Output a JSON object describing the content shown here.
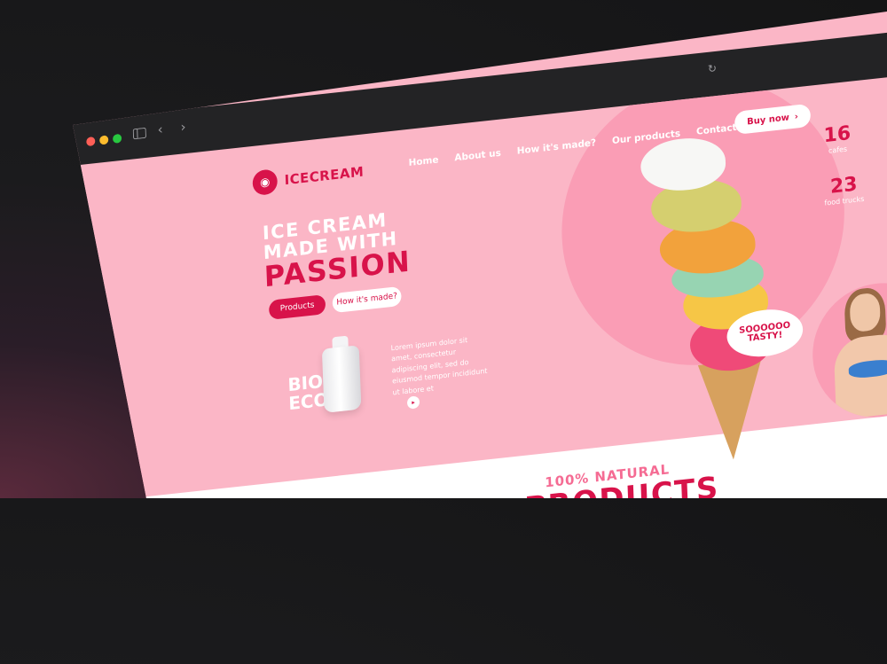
{
  "browser": {
    "refresh_icon": "refresh-icon",
    "sidebar_icon": "sidebar-icon",
    "back_icon": "chevron-left-icon",
    "forward_icon": "chevron-right-icon"
  },
  "site": {
    "brand": "ICECREAM",
    "nav": [
      "Home",
      "About us",
      "How it's made?",
      "Our products",
      "Contact"
    ],
    "buy_button": "Buy now",
    "hero": {
      "line1": "ICE CREAM",
      "line2": "MADE WITH",
      "line3": "PASSION",
      "primary_button": "Products",
      "secondary_button": "How it's made?"
    },
    "bio": {
      "line1": "BIO",
      "line2": "ECO"
    },
    "lorem": "Lorem ipsum dolor sit amet, consectetur adipiscing elit, sed do eiusmod tempor incididunt ut labore et",
    "stats": [
      {
        "number": "16",
        "label": "cafes"
      },
      {
        "number": "23",
        "label": "food trucks"
      }
    ],
    "bubble": {
      "line1": "SOOOOOO",
      "line2": "TASTY!"
    },
    "section": {
      "subtitle": "100% NATURAL",
      "title": "PRODUCTS"
    }
  },
  "colors": {
    "brand": "#d8134a",
    "pink_bg": "#fbb6c6",
    "pink_circle": "#fa9db5"
  }
}
